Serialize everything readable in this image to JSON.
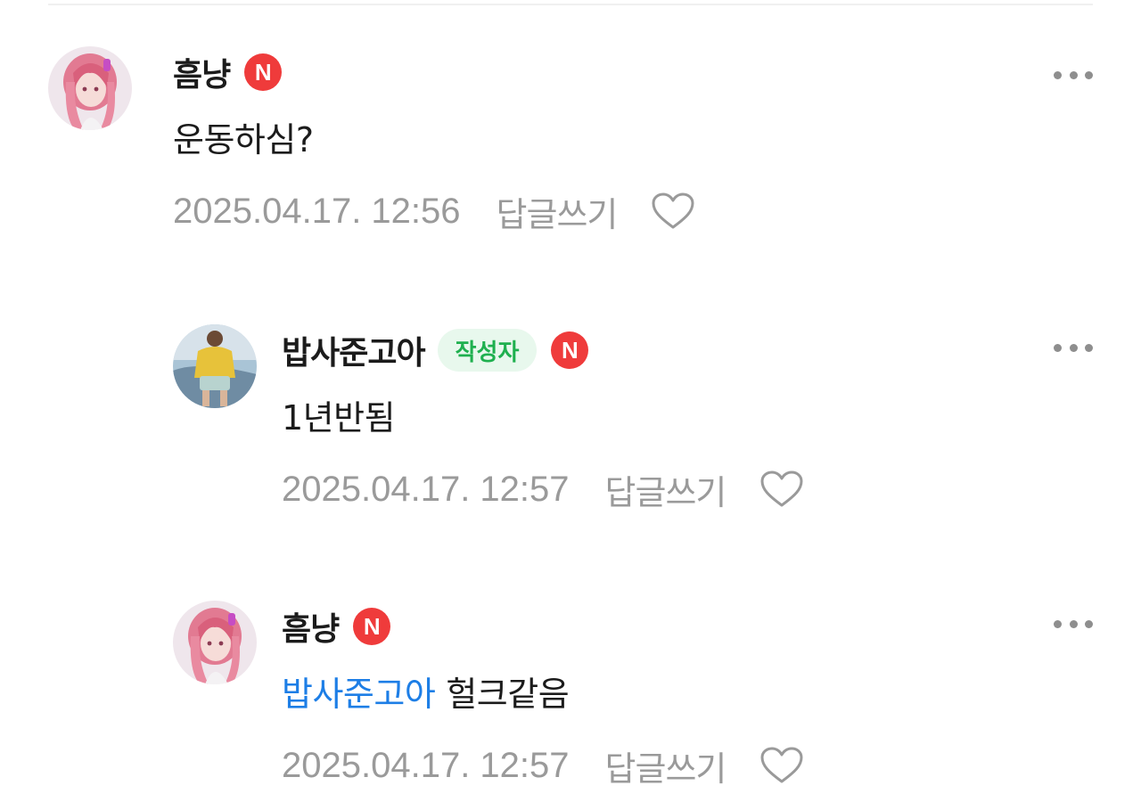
{
  "comments": [
    {
      "author": "흠냥",
      "badge": "N",
      "text": "운동하심?",
      "timestamp": "2025.04.17. 12:56",
      "reply_label": "답글쓰기",
      "avatar_icon": "anime-girl-avatar",
      "more_icon": "more-dots-icon",
      "like_icon": "heart-outline-icon"
    },
    {
      "author": "밥사준고아",
      "writer_badge": "작성자",
      "badge": "N",
      "text": "1년반됨",
      "timestamp": "2025.04.17. 12:57",
      "reply_label": "답글쓰기",
      "avatar_icon": "person-photo-avatar",
      "more_icon": "more-dots-icon",
      "like_icon": "heart-outline-icon"
    },
    {
      "author": "흠냥",
      "badge": "N",
      "mention": "밥사준고아",
      "text": "헐크같음",
      "timestamp": "2025.04.17. 12:57",
      "reply_label": "답글쓰기",
      "avatar_icon": "anime-girl-avatar",
      "more_icon": "more-dots-icon",
      "like_icon": "heart-outline-icon"
    }
  ],
  "colors": {
    "mention": "#1d7ee6",
    "writer_badge_bg": "#e8f8ed",
    "writer_badge_text": "#1fb04f",
    "n_badge": "#ef3b3b",
    "meta_text": "#9a9a9a"
  }
}
